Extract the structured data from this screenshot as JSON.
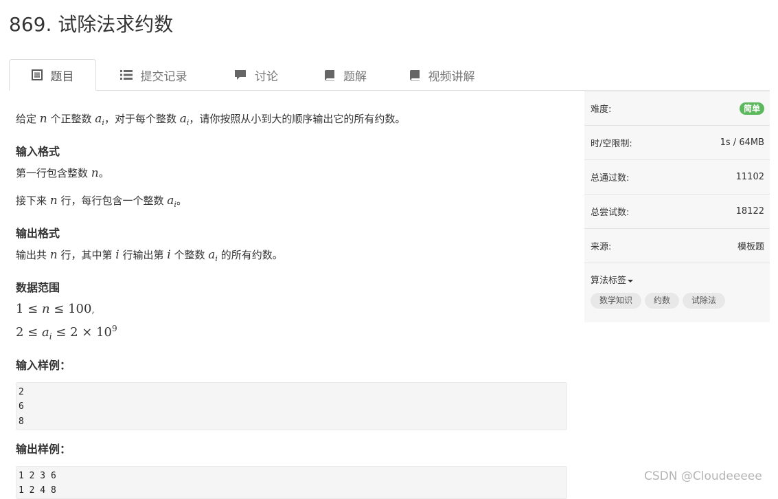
{
  "problem": {
    "title": "869. 试除法求约数"
  },
  "tabs": [
    {
      "label": "题目",
      "icon": "list-icon",
      "active": true
    },
    {
      "label": "提交记录",
      "icon": "bullet-list-icon"
    },
    {
      "label": "讨论",
      "icon": "comment-icon"
    },
    {
      "label": "题解",
      "icon": "book-icon"
    },
    {
      "label": "视频讲解",
      "icon": "book-icon"
    }
  ],
  "description": {
    "p1": {
      "t1": "给定 ",
      "m1": "n",
      "t2": " 个正整数 ",
      "m2": "a",
      "s2": "i",
      "t3": "，对于每个整数 ",
      "m3": "a",
      "s3": "i",
      "t4": "，请你按照从小到大的顺序输出它的所有约数。"
    },
    "input_heading": "输入格式",
    "input_line1": {
      "t1": "第一行包含整数 ",
      "m1": "n",
      "t2": "。"
    },
    "input_line2": {
      "t1": "接下来 ",
      "m1": "n",
      "t2": " 行，每行包含一个整数 ",
      "m2": "a",
      "s2": "i",
      "t3": "。"
    },
    "output_heading": "输出格式",
    "output_line": {
      "t1": "输出共 ",
      "m1": "n",
      "t2": " 行，其中第 ",
      "m2": "i",
      "t3": " 行输出第 ",
      "m3": "i",
      "t4": " 个整数 ",
      "m4": "a",
      "s4": "i",
      "t5": " 的所有约数。"
    },
    "range_heading": "数据范围",
    "range_line1": {
      "a": "1 ≤ ",
      "b": "n",
      "c": " ≤ 100",
      "d": ","
    },
    "range_line2": {
      "a": "2 ≤ ",
      "b": "a",
      "sub": "i",
      "c": " ≤ 2 × 10",
      "sup": "9"
    },
    "sample_input_heading": "输入样例：",
    "sample_input": "2\n6\n8",
    "sample_output_heading": "输出样例：",
    "sample_output": "1 2 3 6 \n1 2 4 8"
  },
  "sidebar": {
    "difficulty_label": "难度:",
    "difficulty_value": "简单",
    "limit_label": "时/空限制:",
    "limit_value": "1s / 64MB",
    "passed_label": "总通过数:",
    "passed_value": "11102",
    "attempts_label": "总尝试数:",
    "attempts_value": "18122",
    "source_label": "来源:",
    "source_value": "模板题",
    "tags_label": "算法标签",
    "tags": [
      "数学知识",
      "约数",
      "试除法"
    ]
  },
  "watermark": "CSDN @Cloudeeeee",
  "colors": {
    "difficulty_badge": "#5cb85c",
    "tab_text": "#777777",
    "icon": "#555555"
  }
}
